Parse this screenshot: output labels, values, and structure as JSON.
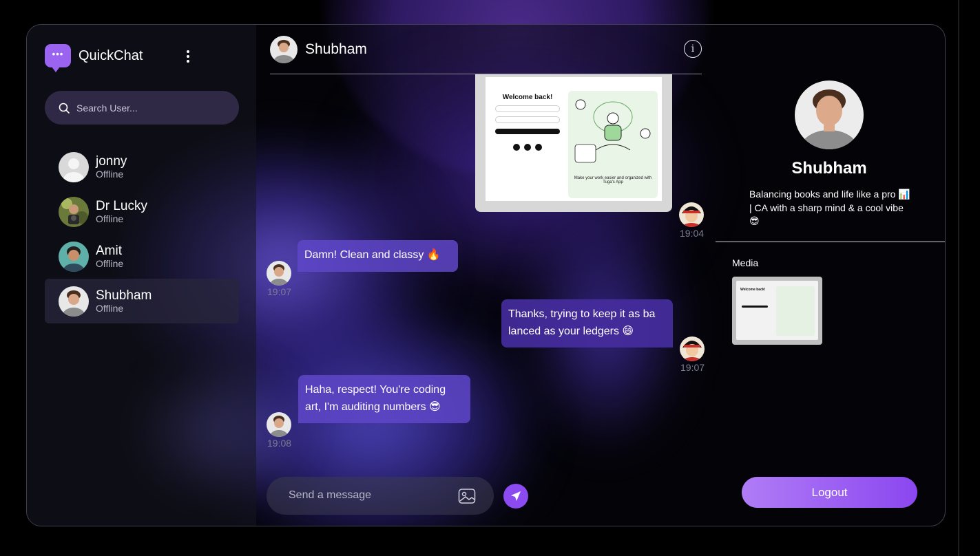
{
  "app": {
    "name": "QuickChat"
  },
  "search": {
    "placeholder": "Search User..."
  },
  "users": [
    {
      "name": "jonny",
      "status": "Offline"
    },
    {
      "name": "Dr Lucky",
      "status": "Offline"
    },
    {
      "name": "Amit",
      "status": "Offline"
    },
    {
      "name": "Shubham",
      "status": "Offline"
    }
  ],
  "chat": {
    "contact_name": "Shubham",
    "messages": [
      {
        "type": "image",
        "side": "right",
        "time": "19:04",
        "preview": {
          "title": "Welcome back!",
          "caption": "Make your work easier and organized with Tuga's App"
        }
      },
      {
        "type": "text",
        "side": "left",
        "text": "Damn! Clean and classy 🔥",
        "time": "19:07"
      },
      {
        "type": "text",
        "side": "right",
        "text": "Thanks, trying to keep it as ba lanced as your ledgers 😄",
        "time": "19:07"
      },
      {
        "type": "text",
        "side": "left",
        "text": "Haha, respect! You're coding art, I'm auditing numbers 😎",
        "time": "19:08"
      }
    ],
    "composer_placeholder": "Send a message"
  },
  "profile": {
    "name": "Shubham",
    "bio": "Balancing books and life like a pro 📊 | CA with a sharp mind & a cool vibe 😎",
    "media_label": "Media",
    "media_preview_title": "Welcome back!"
  },
  "logout_label": "Logout",
  "colors": {
    "accent": "#8c4bf0",
    "bubble": "#5f46c8",
    "search_bg": "#2f2946"
  }
}
